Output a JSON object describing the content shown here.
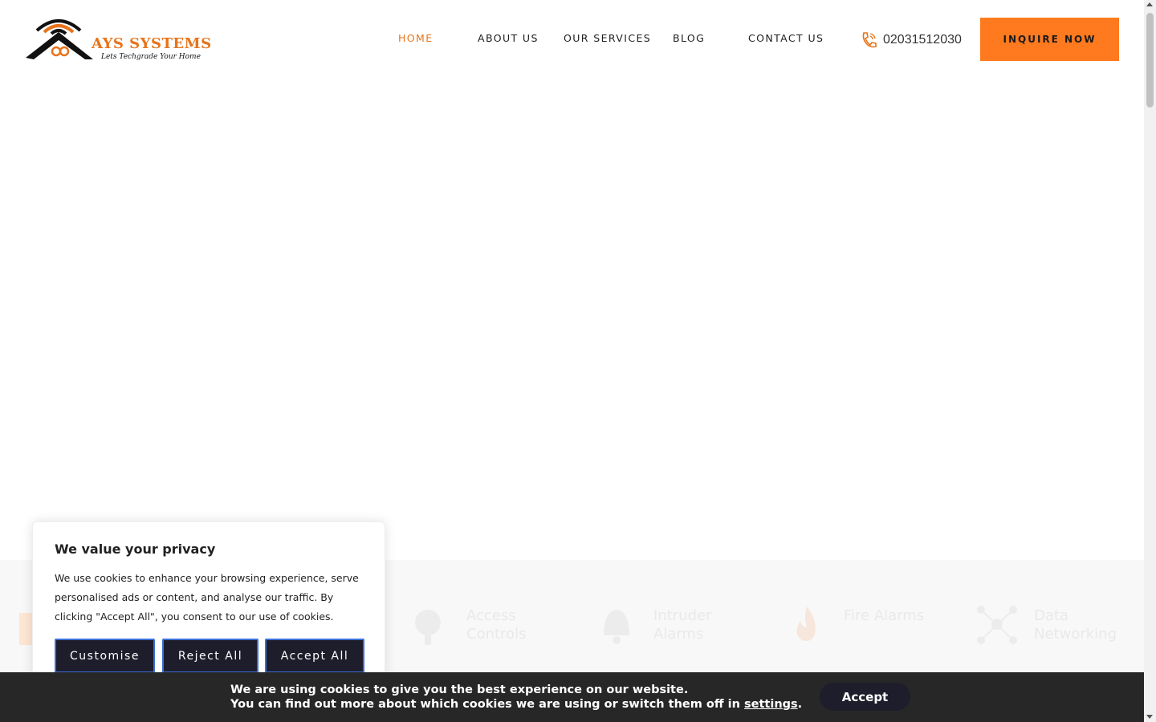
{
  "brand": {
    "name": "AYS SYSTEMS",
    "tagline": "Lets Techgrade Your Home",
    "accent_color": "#ff7a1f"
  },
  "nav": {
    "items": [
      {
        "label": "HOME",
        "active": true
      },
      {
        "label": "ABOUT US",
        "active": false
      },
      {
        "label": "OUR SERVICES",
        "active": false
      },
      {
        "label": "BLOG",
        "active": false
      },
      {
        "label": "CONTACT US",
        "active": false
      }
    ],
    "phone": {
      "icon": "phone-icon",
      "number": "02031512030"
    },
    "cta_label": "INQUIRE NOW"
  },
  "services": {
    "items": [
      {
        "label": "Access Controls",
        "icon": "access-control-icon"
      },
      {
        "label": "Intruder Alarms",
        "icon": "alarm-bell-icon"
      },
      {
        "label": "Fire Alarms",
        "icon": "fire-icon"
      },
      {
        "label": "Data Networking",
        "icon": "network-icon"
      }
    ]
  },
  "consent": {
    "title": "We value your privacy",
    "text": "We use cookies to enhance your browsing experience, serve personalised ads or content, and analyse our traffic. By clicking \"Accept All\", you consent to our use of cookies.",
    "buttons": {
      "customise": "Customise",
      "reject": "Reject All",
      "accept": "Accept All"
    },
    "button_bg": "#1e1d2b",
    "button_border": "#3a6fd8"
  },
  "cookie_bar": {
    "line1": "We are using cookies to give you the best experience on our website.",
    "line2_prefix": "You can find out more about which cookies we are using or switch them off in ",
    "line2_link": "settings",
    "line2_suffix": ".",
    "accept_label": "Accept"
  }
}
